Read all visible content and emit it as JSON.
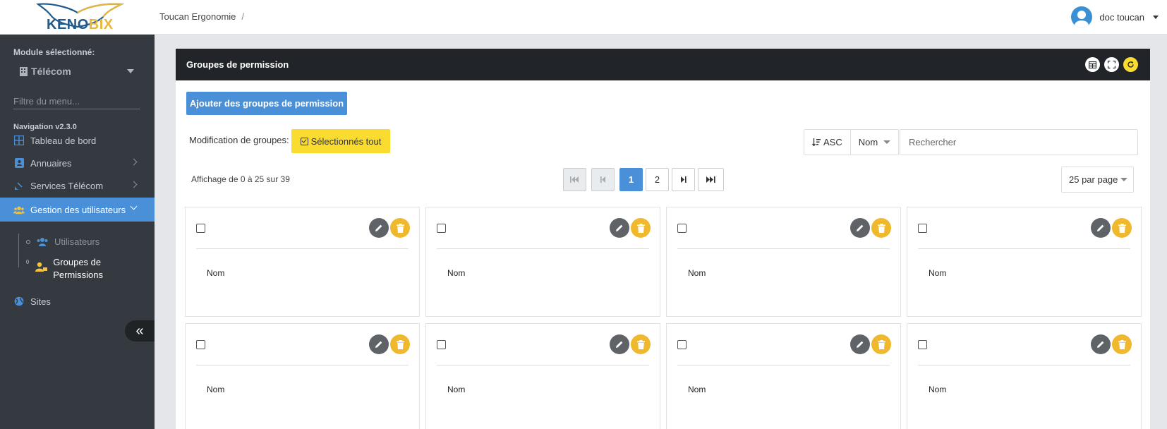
{
  "header": {
    "logo_text_left": "KEN",
    "logo_text_mid": "O",
    "logo_text_right": "BIX",
    "breadcrumb": "Toucan Ergonomie",
    "breadcrumb_sep": "/",
    "user_name": "doc toucan"
  },
  "sidebar": {
    "module_label": "Module sélectionné:",
    "module_value": "Télécom",
    "filter_placeholder": "Filtre du menu...",
    "version": "Navigation v2.3.0",
    "items": [
      {
        "label": "Tableau de bord",
        "icon": "dashboard-icon"
      },
      {
        "label": "Annuaires",
        "icon": "address-book-icon"
      },
      {
        "label": "Services Télécom",
        "icon": "satellite-dish-icon"
      },
      {
        "label": "Gestion des utilisateurs",
        "icon": "users-icon"
      },
      {
        "label": "Sites",
        "icon": "globe-icon"
      }
    ],
    "subitems": [
      {
        "label": "Utilisateurs",
        "icon": "users-icon"
      },
      {
        "label": "Groupes de Permissions",
        "icon": "user-lock-icon"
      }
    ],
    "collapse_glyph": "«"
  },
  "panel": {
    "title": "Groupes de permission",
    "add_button": "Ajouter des groupes de permission",
    "modification_label": "Modification de groupes:",
    "select_all_button": "Sélectionnés tout",
    "sort_order": "ASC",
    "sort_field": "Nom",
    "search_placeholder": "Rechercher",
    "count_text": "Affichage de 0 à 25 sur 39",
    "pages": [
      "1",
      "2"
    ],
    "current_page": "1",
    "per_page": "25 par page"
  },
  "cards": [
    {
      "field": "Nom"
    },
    {
      "field": "Nom"
    },
    {
      "field": "Nom"
    },
    {
      "field": "Nom"
    },
    {
      "field": "Nom"
    },
    {
      "field": "Nom"
    },
    {
      "field": "Nom"
    },
    {
      "field": "Nom"
    }
  ],
  "colors": {
    "sidebar_bg": "#343a40",
    "active_blue": "#4a90d9",
    "panel_header": "#212529",
    "accent_yellow": "#fadb2f",
    "delete_yellow": "#f0b92d"
  }
}
